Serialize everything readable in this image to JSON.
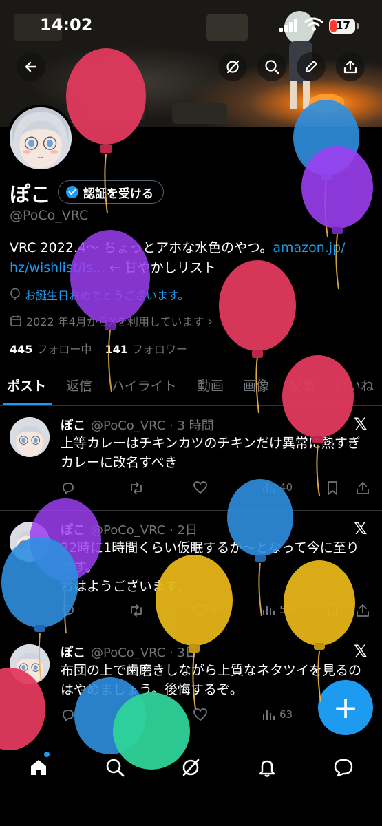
{
  "status_bar": {
    "time": "14:02",
    "battery": "17"
  },
  "colors": {
    "accent": "#1d9bf0",
    "background": "#000000",
    "muted": "#71767b"
  },
  "header": {
    "back_icon": "back-arrow-icon",
    "grok_icon": "grok-icon",
    "search_icon": "search-icon",
    "edit_icon": "edit-icon",
    "share_icon": "share-icon"
  },
  "profile": {
    "name": "ぽこ",
    "verify_label": "認証を受ける",
    "handle": "@PoCo_VRC",
    "bio_prefix": "VRC 2022.4〜 ちょっとアホな水色のやつ。",
    "bio_link": "amazon.jp/ hz/wishlist/ls...",
    "bio_suffix": " ← 甘やかしリスト",
    "birthday": "お誕生日おめでとうございます。",
    "joined": "2022 年4月からXを利用しています",
    "following_count": "445",
    "following_label": "フォロー中",
    "followers_count": "141",
    "followers_label": "フォロワー"
  },
  "tabs": [
    "ポスト",
    "返信",
    "ハイライト",
    "動画",
    "画像",
    "記事",
    "いいね"
  ],
  "posts": [
    {
      "name": "ぽこ",
      "meta": "@PoCo_VRC · 3 時間",
      "text": "上等カレーはチキンカツのチキンだけ異常に熱すぎカレーに改名すべき",
      "likes": "",
      "views": "40"
    },
    {
      "name": "ぽこ",
      "meta": "@PoCo_VRC · 2日",
      "text_lines": [
        "22時に1時間くらい仮眠するか〜となって今に至り",
        "ます。",
        "おはようございます。"
      ],
      "likes": "2",
      "views": "52"
    },
    {
      "name": "ぽこ",
      "meta": "@PoCo_VRC · 3日",
      "text": "布団の上で歯磨きしながら上質なネタツイを見るのはやめましょう。後悔するぞ。",
      "likes": "",
      "views": "63"
    }
  ],
  "fab": {
    "label": "+"
  },
  "bottom_nav": [
    "home-icon",
    "search-icon",
    "grok-icon",
    "notifications-icon",
    "messages-icon"
  ]
}
